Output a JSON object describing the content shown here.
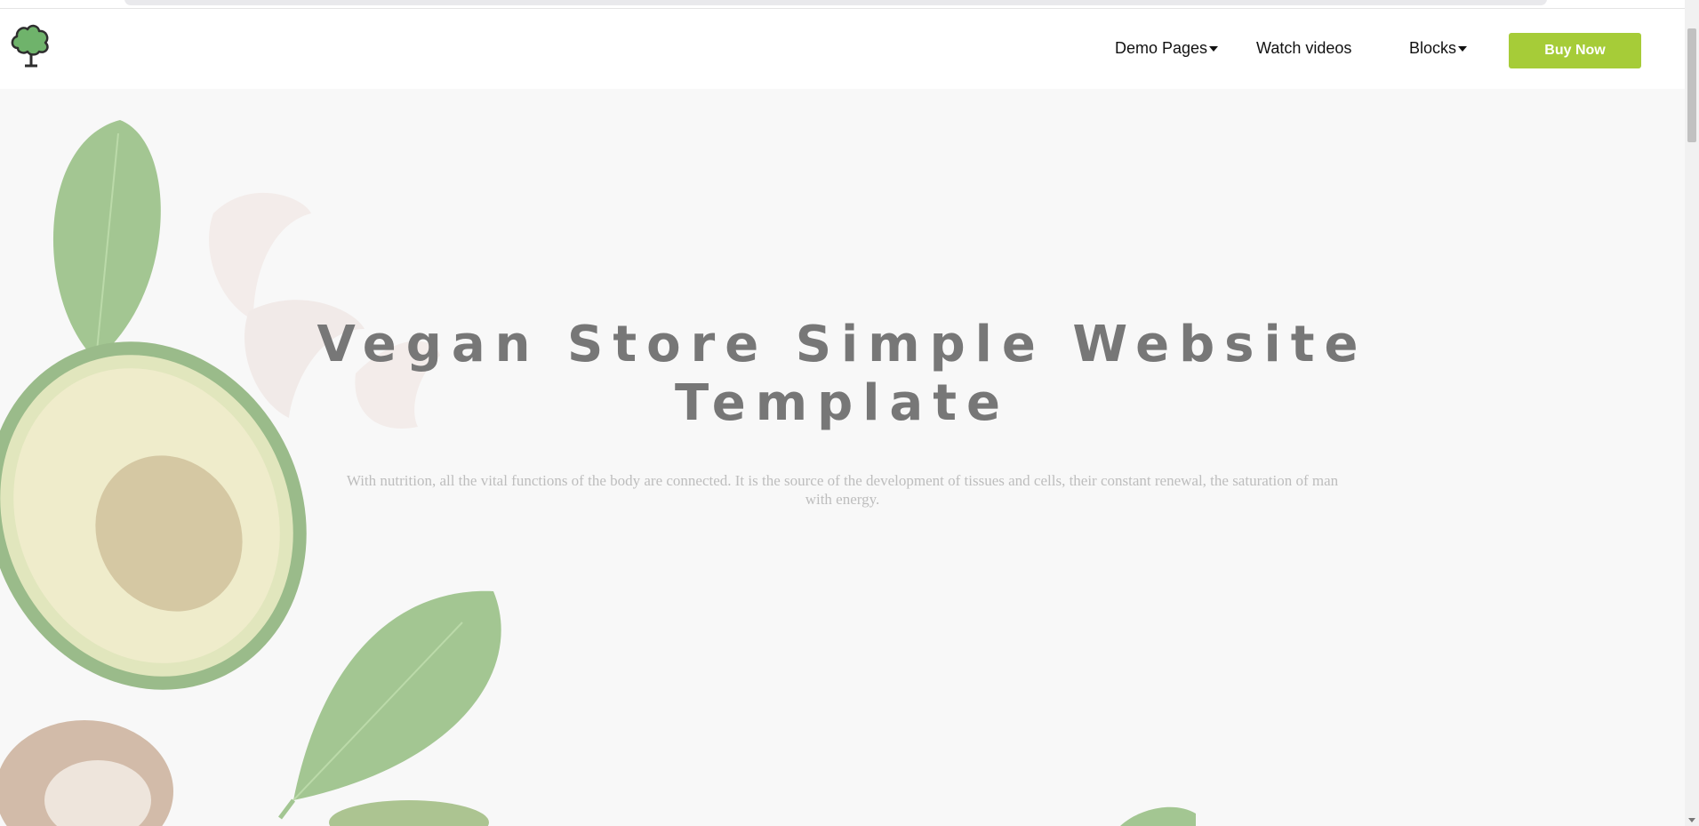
{
  "navbar": {
    "logo_icon": "broccoli-tree-icon",
    "items": [
      {
        "label": "Demo Pages",
        "dropdown": true
      },
      {
        "label": "Watch videos",
        "dropdown": false
      },
      {
        "label": "Blocks",
        "dropdown": true
      }
    ],
    "cta_label": "Buy Now"
  },
  "hero": {
    "title": "Vegan Store Simple Website Template",
    "subtitle": "With nutrition, all the vital functions of the body are connected. It is the source of the development of tissues and cells, their constant renewal, the saturation of man with energy."
  },
  "colors": {
    "accent": "#a6cc38",
    "title": "#777777",
    "hero_bg": "#f8f8f8"
  }
}
